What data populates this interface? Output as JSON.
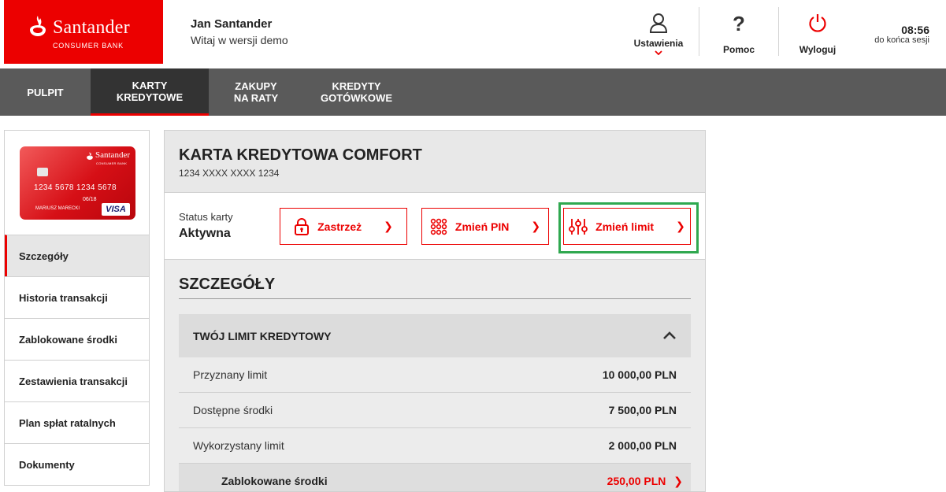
{
  "brand": {
    "name": "Santander",
    "sub": "CONSUMER BANK"
  },
  "user": {
    "name": "Jan Santander",
    "greeting": "Witaj w wersji demo"
  },
  "header": {
    "settings_label": "Ustawienia",
    "help_label": "Pomoc",
    "logout_label": "Wyloguj",
    "session_time": "08:56",
    "session_label": "do końca sesji"
  },
  "nav": [
    {
      "label": "PULPIT"
    },
    {
      "label": "KARTY\nKREDYTOWE"
    },
    {
      "label": "ZAKUPY\nNA RATY"
    },
    {
      "label": "KREDYTY\nGOTÓWKOWE"
    }
  ],
  "card_image": {
    "brand": "Santander",
    "sub": "CONSUMER BANK",
    "number": "1234 5678 1234 5678",
    "expiry": "06/18",
    "holder": "MARIUSZ MARECKI",
    "network": "VISA"
  },
  "sidebar": [
    {
      "label": "Szczegóły"
    },
    {
      "label": "Historia transakcji"
    },
    {
      "label": "Zablokowane środki"
    },
    {
      "label": "Zestawienia transakcji"
    },
    {
      "label": "Plan spłat ratalnych"
    },
    {
      "label": "Dokumenty"
    }
  ],
  "card": {
    "title": "KARTA KREDYTOWA COMFORT",
    "number": "1234 XXXX XXXX 1234"
  },
  "status": {
    "label": "Status karty",
    "value": "Aktywna"
  },
  "actions": {
    "block": "Zastrzeż",
    "pin": "Zmień PIN",
    "limit": "Zmień limit"
  },
  "details": {
    "title": "SZCZEGÓŁY",
    "section_title": "TWÓJ LIMIT KREDYTOWY",
    "rows": [
      {
        "label": "Przyznany limit",
        "value": "10 000,00 PLN"
      },
      {
        "label": "Dostępne środki",
        "value": "7 500,00 PLN"
      },
      {
        "label": "Wykorzystany limit",
        "value": "2 000,00 PLN"
      },
      {
        "label": "Zablokowane środki",
        "value": "250,00 PLN"
      }
    ]
  },
  "colors": {
    "brand_red": "#ec0000",
    "nav_bg": "#5a5a5a",
    "nav_active": "#333333",
    "highlight": "#2fa84f"
  }
}
